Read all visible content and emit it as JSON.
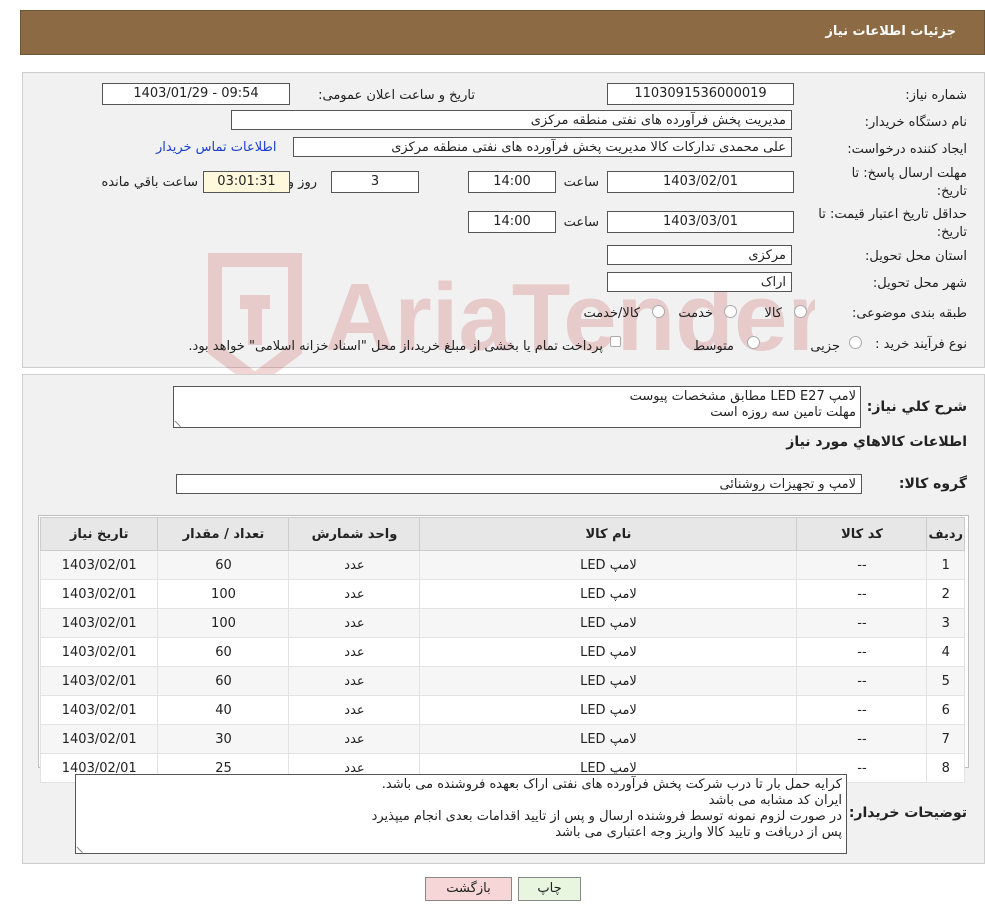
{
  "header": {
    "title": "جزئیات اطلاعات نیاز"
  },
  "info": {
    "need_number_label": "شماره نیاز:",
    "need_number": "1103091536000019",
    "announce_label": "تاریخ و ساعت اعلان عمومی:",
    "announce_value": "1403/01/29 - 09:54",
    "buyer_org_label": "نام دستگاه خریدار:",
    "buyer_org": "مدیریت پخش فرآورده های نفتی منطقه مرکزی",
    "creator_label": "ایجاد کننده درخواست:",
    "creator": "علی محمدی تدارکات کالا مدیریت پخش فرآورده های نفتی منطقه مرکزی",
    "contact_link": "اطلاعات تماس خریدار",
    "deadline_label_1": "مهلت ارسال پاسخ: تا",
    "deadline_label_2": "تاریخ:",
    "deadline_date": "1403/02/01",
    "time_label": "ساعت",
    "deadline_time": "14:00",
    "days_value": "3",
    "days_label": "روز و",
    "remaining_value": "03:01:31",
    "remaining_label": "ساعت باقي مانده",
    "price_label_1": "حداقل تاریخ اعتبار قیمت: تا",
    "price_label_2": "تاریخ:",
    "price_date": "1403/03/01",
    "price_time_label": "ساعت",
    "price_time": "14:00",
    "province_label": "استان محل تحویل:",
    "province": "مرکزی",
    "city_label": "شهر محل تحویل:",
    "city": "اراک",
    "category_label": "طبقه بندی موضوعی:",
    "category_options": [
      "کالا",
      "خدمت",
      "کالا/خدمت"
    ],
    "process_label": "نوع فرآیند خرید :",
    "process_options": [
      "جزیی",
      "متوسط"
    ],
    "process_note": "پرداخت تمام یا بخشی از مبلغ خرید،از محل \"اسناد خزانه اسلامی\" خواهد بود."
  },
  "description": {
    "label": "شرح کلي نياز:",
    "lines": [
      "لامپ LED E27 مطابق مشخصات پیوست",
      "مهلت تامین سه روزه است"
    ]
  },
  "goods": {
    "section_title": "اطلاعات كالاهاي مورد نياز",
    "group_label": "گروه کالا:",
    "group_value": "لامپ و تجهیزات روشنائی"
  },
  "table": {
    "headers": [
      "ردیف",
      "کد کالا",
      "نام کالا",
      "واحد شمارش",
      "تعداد / مقدار",
      "تاریخ نیاز"
    ],
    "rows": [
      [
        "1",
        "--",
        "لامپ LED",
        "عدد",
        "60",
        "1403/02/01"
      ],
      [
        "2",
        "--",
        "لامپ LED",
        "عدد",
        "100",
        "1403/02/01"
      ],
      [
        "3",
        "--",
        "لامپ LED",
        "عدد",
        "100",
        "1403/02/01"
      ],
      [
        "4",
        "--",
        "لامپ LED",
        "عدد",
        "60",
        "1403/02/01"
      ],
      [
        "5",
        "--",
        "لامپ LED",
        "عدد",
        "60",
        "1403/02/01"
      ],
      [
        "6",
        "--",
        "لامپ LED",
        "عدد",
        "40",
        "1403/02/01"
      ],
      [
        "7",
        "--",
        "لامپ LED",
        "عدد",
        "30",
        "1403/02/01"
      ],
      [
        "8",
        "--",
        "لامپ LED",
        "عدد",
        "25",
        "1403/02/01"
      ]
    ]
  },
  "buyer_notes": {
    "label": "توضیحات خریدار:",
    "lines": [
      "کرایه حمل بار تا درب شرکت  پخش فرآورده های نفتی اراک بعهده فروشنده می باشد.",
      "ایران کد مشابه می باشد",
      "در صورت لزوم نمونه توسط فروشنده ارسال و پس از تایید اقدامات بعدی انجام میپذیرد",
      "پس از دریافت و تایید کالا واریز وجه اعتباری می باشد"
    ]
  },
  "buttons": {
    "print": "چاپ",
    "back": "بازگشت"
  },
  "watermark": {
    "text": "AriaTender.neT"
  },
  "colors": {
    "header_bg": "#8b6a44",
    "link": "#1a3fd1",
    "back_btn": "#f6d6d6",
    "print_btn": "#e8f6e0"
  }
}
